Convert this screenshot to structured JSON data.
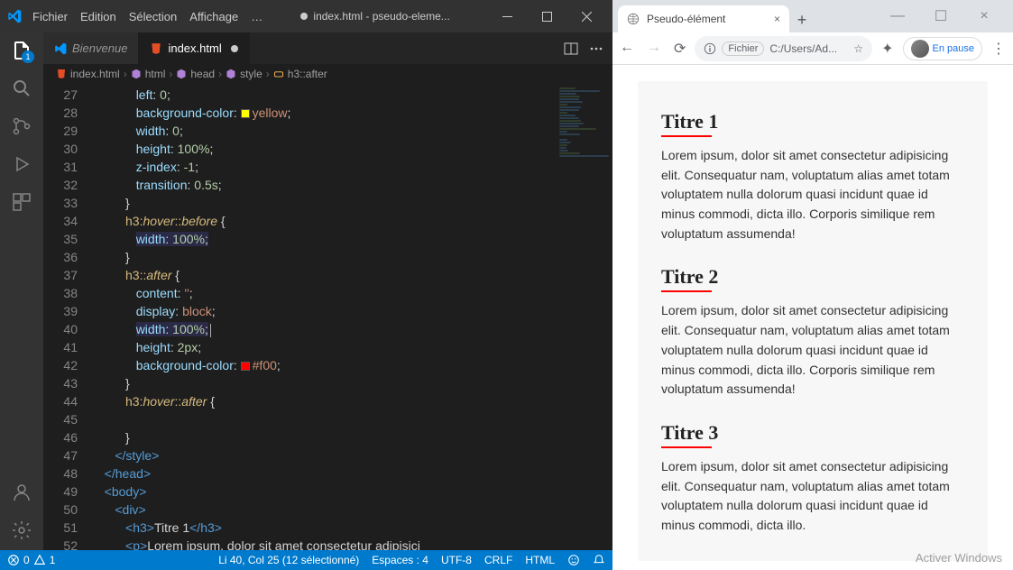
{
  "vscode": {
    "menu": [
      "Fichier",
      "Edition",
      "Sélection",
      "Affichage",
      "…"
    ],
    "windowTitle": "index.html - pseudo-eleme...",
    "activityBadge": "1",
    "tabs": [
      {
        "label": "Bienvenue",
        "active": false
      },
      {
        "label": "index.html",
        "active": true
      }
    ],
    "breadcrumb": [
      "index.html",
      "html",
      "head",
      "style",
      "h3::after"
    ],
    "gutterStart": 27,
    "code": [
      [
        [
          "            ",
          "c-text"
        ],
        [
          "left",
          "c-prop"
        ],
        [
          ": ",
          "c-punct"
        ],
        [
          "0",
          "c-num"
        ],
        [
          ";",
          "c-punct"
        ]
      ],
      [
        [
          "            ",
          "c-text"
        ],
        [
          "background-color",
          "c-prop"
        ],
        [
          ": ",
          "c-punct"
        ],
        [
          "SWATCH_YELLOW",
          "swatch"
        ],
        [
          "yellow",
          "c-val"
        ],
        [
          ";",
          "c-punct"
        ]
      ],
      [
        [
          "            ",
          "c-text"
        ],
        [
          "width",
          "c-prop"
        ],
        [
          ": ",
          "c-punct"
        ],
        [
          "0",
          "c-num"
        ],
        [
          ";",
          "c-punct"
        ]
      ],
      [
        [
          "            ",
          "c-text"
        ],
        [
          "height",
          "c-prop"
        ],
        [
          ": ",
          "c-punct"
        ],
        [
          "100%",
          "c-num"
        ],
        [
          ";",
          "c-punct"
        ]
      ],
      [
        [
          "            ",
          "c-text"
        ],
        [
          "z-index",
          "c-prop"
        ],
        [
          ": ",
          "c-punct"
        ],
        [
          "-1",
          "c-num"
        ],
        [
          ";",
          "c-punct"
        ]
      ],
      [
        [
          "            ",
          "c-text"
        ],
        [
          "transition",
          "c-prop"
        ],
        [
          ": ",
          "c-punct"
        ],
        [
          "0.5s",
          "c-num"
        ],
        [
          ";",
          "c-punct"
        ]
      ],
      [
        [
          "         ",
          "c-text"
        ],
        [
          "}",
          "c-punct"
        ]
      ],
      [
        [
          "         ",
          "c-text"
        ],
        [
          "h3",
          "c-sel"
        ],
        [
          ":",
          "c-pseudo"
        ],
        [
          "hover",
          "c-pseudo-italic"
        ],
        [
          "::",
          "c-pseudo"
        ],
        [
          "before",
          "c-pseudo-italic"
        ],
        [
          " {",
          "c-punct"
        ]
      ],
      [
        [
          "            ",
          "c-text"
        ],
        [
          "width",
          "c-prop hl"
        ],
        [
          ": ",
          "c-punct hl"
        ],
        [
          "100%",
          "c-num hl"
        ],
        [
          ";",
          "c-punct hl"
        ]
      ],
      [
        [
          "         ",
          "c-text"
        ],
        [
          "}",
          "c-punct"
        ]
      ],
      [
        [
          "         ",
          "c-text"
        ],
        [
          "h3",
          "c-sel"
        ],
        [
          "::",
          "c-pseudo"
        ],
        [
          "after",
          "c-pseudo-italic"
        ],
        [
          " {",
          "c-punct"
        ]
      ],
      [
        [
          "            ",
          "c-text"
        ],
        [
          "content",
          "c-prop"
        ],
        [
          ": ",
          "c-punct"
        ],
        [
          "''",
          "c-str"
        ],
        [
          ";",
          "c-punct"
        ]
      ],
      [
        [
          "            ",
          "c-text"
        ],
        [
          "display",
          "c-prop"
        ],
        [
          ": ",
          "c-punct"
        ],
        [
          "block",
          "c-val"
        ],
        [
          ";",
          "c-punct"
        ]
      ],
      [
        [
          "            ",
          "c-text"
        ],
        [
          "width",
          "c-prop hl"
        ],
        [
          ": ",
          "c-punct hl"
        ],
        [
          "100%",
          "c-num hl"
        ],
        [
          ";",
          "c-punct hl"
        ],
        [
          "CURSOR",
          ""
        ]
      ],
      [
        [
          "            ",
          "c-text"
        ],
        [
          "height",
          "c-prop"
        ],
        [
          ": ",
          "c-punct"
        ],
        [
          "2px",
          "c-num"
        ],
        [
          ";",
          "c-punct"
        ]
      ],
      [
        [
          "            ",
          "c-text"
        ],
        [
          "background-color",
          "c-prop"
        ],
        [
          ": ",
          "c-punct"
        ],
        [
          "SWATCH_RED",
          "swatch"
        ],
        [
          "#f00",
          "c-val"
        ],
        [
          ";",
          "c-punct"
        ]
      ],
      [
        [
          "         ",
          "c-text"
        ],
        [
          "}",
          "c-punct"
        ]
      ],
      [
        [
          "         ",
          "c-text"
        ],
        [
          "h3",
          "c-sel"
        ],
        [
          ":",
          "c-pseudo"
        ],
        [
          "hover",
          "c-pseudo-italic"
        ],
        [
          "::",
          "c-pseudo"
        ],
        [
          "after",
          "c-pseudo-italic"
        ],
        [
          " {",
          "c-punct"
        ]
      ],
      [
        [
          "",
          "c-text"
        ]
      ],
      [
        [
          "         ",
          "c-text"
        ],
        [
          "}",
          "c-punct"
        ]
      ],
      [
        [
          "      ",
          "c-text"
        ],
        [
          "</",
          "c-tag"
        ],
        [
          "style",
          "c-tag"
        ],
        [
          ">",
          "c-tag"
        ]
      ],
      [
        [
          "   ",
          "c-text"
        ],
        [
          "</",
          "c-tag"
        ],
        [
          "head",
          "c-tag"
        ],
        [
          ">",
          "c-tag"
        ]
      ],
      [
        [
          "   ",
          "c-text"
        ],
        [
          "<",
          "c-tag"
        ],
        [
          "body",
          "c-tag"
        ],
        [
          ">",
          "c-tag"
        ]
      ],
      [
        [
          "      ",
          "c-text"
        ],
        [
          "<",
          "c-tag"
        ],
        [
          "div",
          "c-tag"
        ],
        [
          ">",
          "c-tag"
        ]
      ],
      [
        [
          "         ",
          "c-text"
        ],
        [
          "<",
          "c-tag"
        ],
        [
          "h3",
          "c-tag"
        ],
        [
          ">",
          "c-tag"
        ],
        [
          "Titre 1",
          "c-text"
        ],
        [
          "</",
          "c-tag"
        ],
        [
          "h3",
          "c-tag"
        ],
        [
          ">",
          "c-tag"
        ]
      ],
      [
        [
          "         ",
          "c-text"
        ],
        [
          "<",
          "c-tag"
        ],
        [
          "p",
          "c-tag"
        ],
        [
          ">",
          "c-tag"
        ],
        [
          "Lorem ipsum, dolor sit amet consectetur adipisici",
          "c-text"
        ]
      ]
    ],
    "status": {
      "errors": "0",
      "warnings": "1",
      "cursor": "Li 40, Col 25 (12 sélectionné)",
      "spaces": "Espaces : 4",
      "encoding": "UTF-8",
      "eol": "CRLF",
      "lang": "HTML"
    }
  },
  "browser": {
    "tabTitle": "Pseudo-élément",
    "address": "C:/Users/Ad...",
    "addressPrefix": "Fichier",
    "pauseLabel": "En pause",
    "content": [
      {
        "title": "Titre 1",
        "text": "Lorem ipsum, dolor sit amet consectetur adipisicing elit. Consequatur nam, voluptatum alias amet totam voluptatem nulla dolorum quasi incidunt quae id minus commodi, dicta illo. Corporis similique rem voluptatum assumenda!"
      },
      {
        "title": "Titre 2",
        "text": "Lorem ipsum, dolor sit amet consectetur adipisicing elit. Consequatur nam, voluptatum alias amet totam voluptatem nulla dolorum quasi incidunt quae id minus commodi, dicta illo. Corporis similique rem voluptatum assumenda!"
      },
      {
        "title": "Titre 3",
        "text": "Lorem ipsum, dolor sit amet consectetur adipisicing elit. Consequatur nam, voluptatum alias amet totam voluptatem nulla dolorum quasi incidunt quae id minus commodi, dicta illo."
      }
    ]
  },
  "activateWindows": "Activer Windows"
}
